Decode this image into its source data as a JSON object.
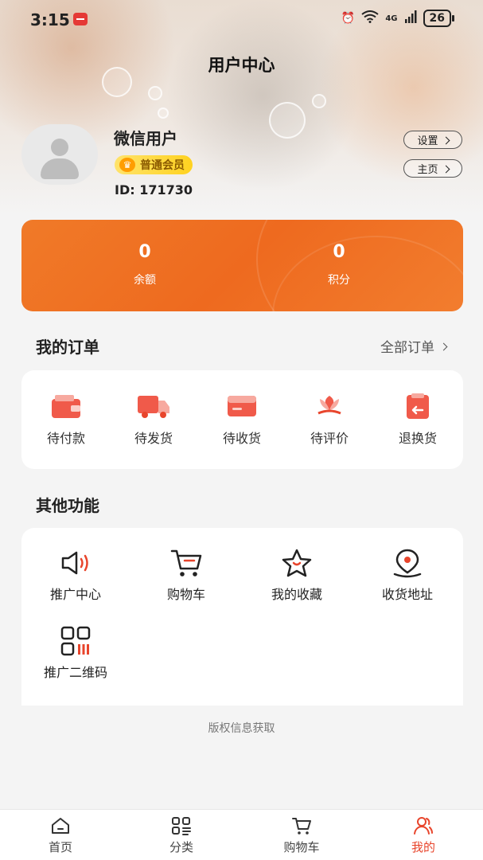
{
  "status_bar": {
    "time": "3:15",
    "network": "4G",
    "battery": "26"
  },
  "page_title": "用户中心",
  "profile": {
    "name": "微信用户",
    "member_level": "普通会员",
    "id_text": "ID: 171730"
  },
  "header_buttons": {
    "settings": "设置",
    "home": "主页"
  },
  "balance_card": {
    "balance_value": "0",
    "balance_label": "余额",
    "points_value": "0",
    "points_label": "积分"
  },
  "orders": {
    "title": "我的订单",
    "all_link": "全部订单",
    "items": [
      {
        "label": "待付款",
        "icon": "wallet-icon"
      },
      {
        "label": "待发货",
        "icon": "truck-icon"
      },
      {
        "label": "待收货",
        "icon": "package-icon"
      },
      {
        "label": "待评价",
        "icon": "flower-icon"
      },
      {
        "label": "退换货",
        "icon": "return-icon"
      }
    ]
  },
  "functions": {
    "title": "其他功能",
    "items": [
      {
        "label": "推广中心",
        "icon": "megaphone-icon"
      },
      {
        "label": "购物车",
        "icon": "cart-icon"
      },
      {
        "label": "我的收藏",
        "icon": "star-icon"
      },
      {
        "label": "收货地址",
        "icon": "location-pin-icon"
      },
      {
        "label": "推广二维码",
        "icon": "qr-code-icon"
      }
    ]
  },
  "copyright": "版权信息获取",
  "tab_bar": {
    "items": [
      {
        "label": "首页",
        "icon": "home-icon"
      },
      {
        "label": "分类",
        "icon": "category-icon"
      },
      {
        "label": "购物车",
        "icon": "cart-icon"
      },
      {
        "label": "我的",
        "icon": "user-icon"
      }
    ],
    "active_index": 3
  },
  "colors": {
    "accent": "#ee6a1f",
    "active_tab": "#e8452c",
    "icon_red": "#e8452c"
  }
}
